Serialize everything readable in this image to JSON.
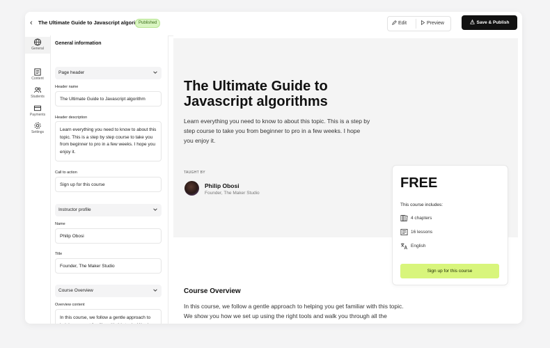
{
  "topbar": {
    "back_icon": "chevron-left-icon",
    "course_title": "The Ultimate Guide to Javascript algorithms",
    "status_badge": "Published",
    "edit_label": "Edit",
    "preview_label": "Preview",
    "publish_label": "Save & Publish"
  },
  "rail": {
    "items": [
      {
        "label": "General",
        "icon": "globe-icon"
      },
      {
        "label": "Content",
        "icon": "content-icon"
      },
      {
        "label": "Students",
        "icon": "users-icon"
      },
      {
        "label": "Payments",
        "icon": "card-icon"
      },
      {
        "label": "Settings",
        "icon": "gear-icon"
      }
    ]
  },
  "editor": {
    "heading": "General information",
    "page_header": {
      "section_label": "Page header",
      "header_name_label": "Header name",
      "header_name_value": "The Ultimate Guide to Javascript algorithm",
      "header_description_label": "Header description",
      "header_description_value": "Learn everything you need to know to about this topic. This is a step by step course to take you from beginner to pro in a few weeks. I hope you enjoy it.",
      "cta_label": "Call to action",
      "cta_value": "Sign up for this course"
    },
    "instructor": {
      "section_label": "Instructor profile",
      "name_label": "Name",
      "name_value": "Philip Obosi",
      "title_label": "Title",
      "title_value": "Founder, The Maker Studio"
    },
    "overview": {
      "section_label": "Course Overview",
      "content_label": "Overview content",
      "content_value": "In this course, we follow a gentle approach to helping you get familiar with this topic. We show you how we set up using the right"
    }
  },
  "preview": {
    "title": "The Ultimate Guide to Javascript algorithms",
    "description": "Learn everything you need to know to about this topic. This is a step by step course to take you from beginner to pro in a few weeks. I hope you enjoy it.",
    "taught_by": "TAUGHT BY",
    "instructor_name": "Philip Obosi",
    "instructor_title": "Founder, The Maker Studio",
    "card": {
      "price": "FREE",
      "includes_label": "This course includes:",
      "items": [
        {
          "icon": "chapters-icon",
          "text": "4 chapters"
        },
        {
          "icon": "lessons-icon",
          "text": "16 lessons"
        },
        {
          "icon": "language-icon",
          "text": "English"
        }
      ],
      "button": "Sign up for this course"
    },
    "overview_title": "Course Overview",
    "overview_text": "In this course, we follow a gentle approach to helping you get familiar with this topic. We show you how we set up using the right tools and walk you through all the things you can do to make the world a better place."
  },
  "colors": {
    "accent_button": "#d8f57c",
    "badge_bg": "#d9f5c2",
    "publish_bg": "#111111"
  }
}
